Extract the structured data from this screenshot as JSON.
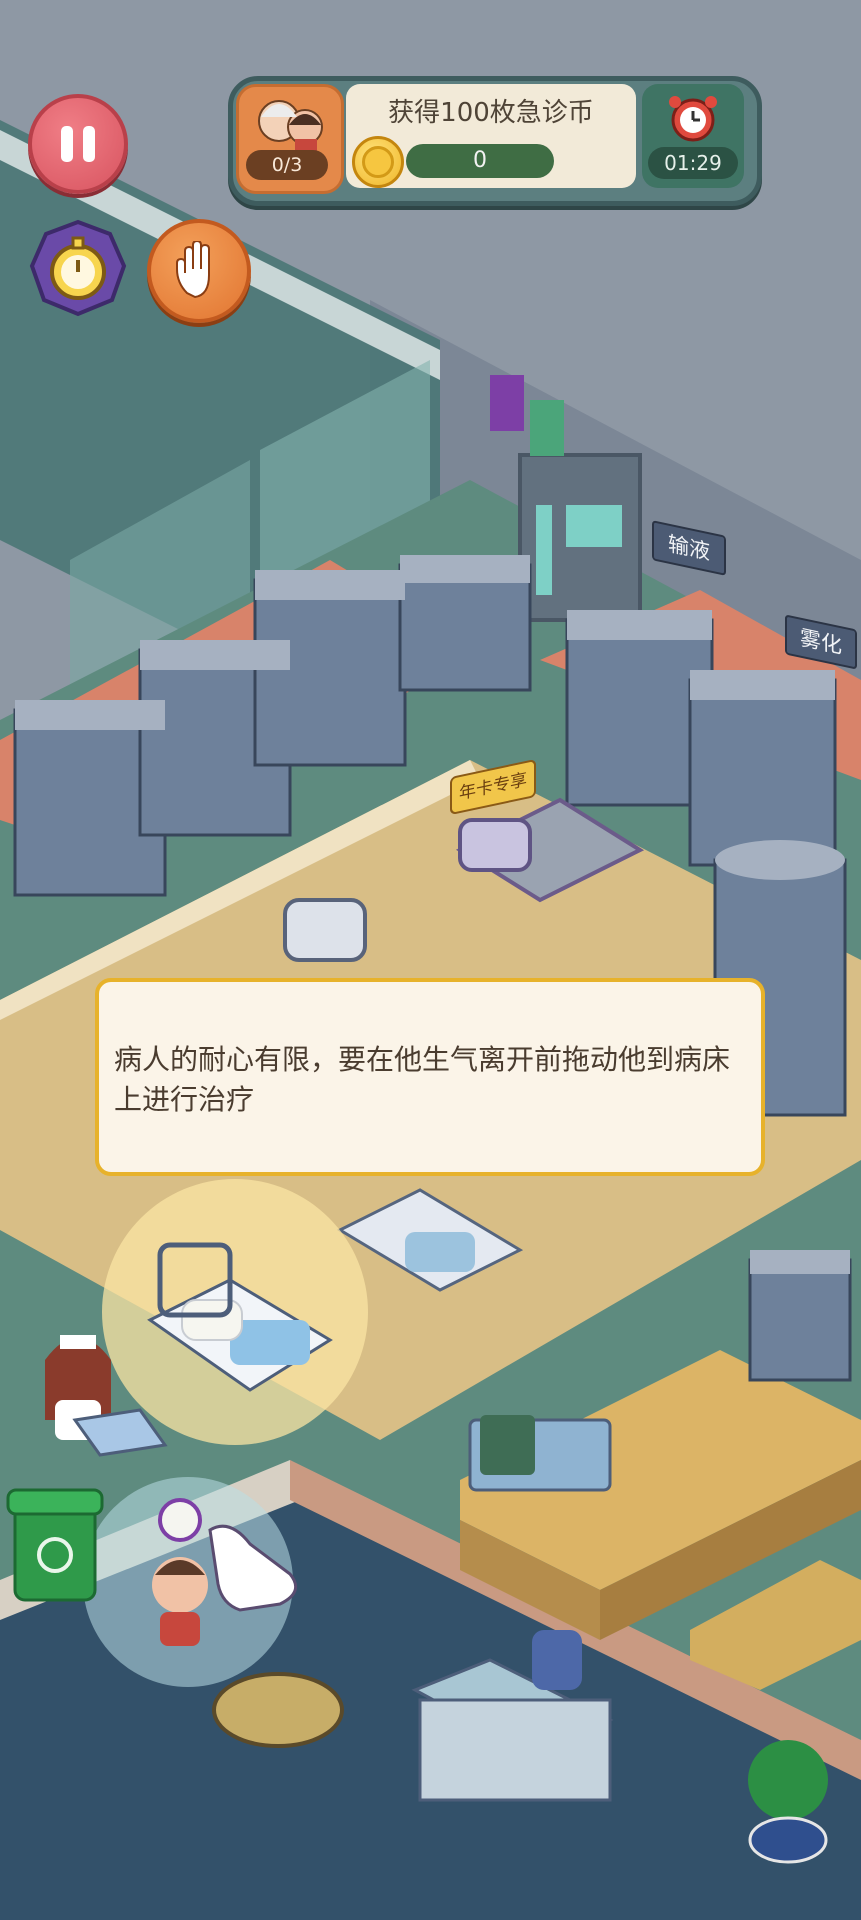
{
  "hud": {
    "pause_icon": "pause-icon",
    "speed_icon": "stopwatch-icon",
    "grab_icon": "hand-icon",
    "patients_count": "0/3",
    "goal_text": "获得100枚急诊币",
    "coin_progress": "0",
    "timer": "01:29",
    "colors": {
      "pause": "#d85460",
      "grab": "#e27531",
      "panel": "#5c7f80"
    }
  },
  "signs": {
    "infusion": "输液",
    "nebulization": "雾化",
    "vip_bed": "年卡专享"
  },
  "tooltip": {
    "text": "病人的耐心有限，要在他生气离开前拖动他到病床上进行治疗"
  }
}
